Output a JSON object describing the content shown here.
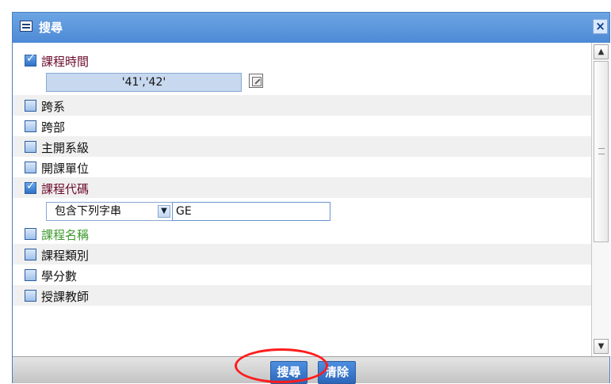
{
  "window": {
    "title": "搜尋",
    "close_glyph": "×",
    "title_icon": "window-list-icon"
  },
  "fields": {
    "course_time": {
      "label": "課程時間",
      "checked": true,
      "value": "'41','42'"
    },
    "cross_department": {
      "label": "跨系",
      "checked": false
    },
    "cross_division": {
      "label": "跨部",
      "checked": false
    },
    "main_department": {
      "label": "主開系級",
      "checked": false
    },
    "offering_unit": {
      "label": "開課單位",
      "checked": false
    },
    "course_code": {
      "label": "課程代碼",
      "checked": true,
      "match_selected": "包含下列字串",
      "value": "GE"
    },
    "course_name": {
      "label": "課程名稱",
      "checked": false
    },
    "course_category": {
      "label": "課程類別",
      "checked": false
    },
    "credits": {
      "label": "學分數",
      "checked": false
    },
    "instructor": {
      "label": "授課教師",
      "checked": false
    }
  },
  "footer": {
    "search_label": "搜尋",
    "clear_label": "清除"
  },
  "colors": {
    "title_bar": "#4d8ad6",
    "checked_label": "#6b0b2a",
    "hover_label": "#3c9a2d",
    "button": "#2c66bb",
    "annotation_circle": "#ff1c1c"
  }
}
